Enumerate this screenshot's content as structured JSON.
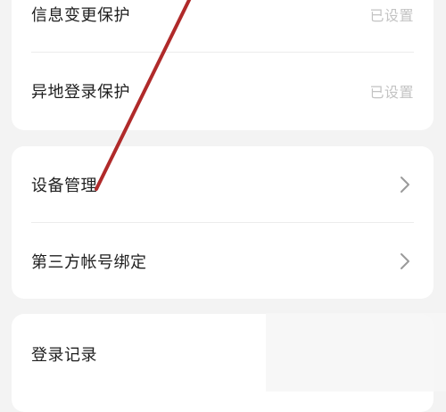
{
  "security_section": {
    "items": [
      {
        "label": "信息变更保护",
        "value": "已设置"
      },
      {
        "label": "异地登录保护",
        "value": "已设置"
      }
    ]
  },
  "device_section": {
    "items": [
      {
        "label": "设备管理",
        "icon": "chevron-right-icon"
      },
      {
        "label": "第三方帐号绑定",
        "icon": "chevron-right-icon"
      }
    ]
  },
  "history_section": {
    "items": [
      {
        "label": "登录记录"
      }
    ]
  },
  "annotation": {
    "color": "#b02a2a"
  }
}
